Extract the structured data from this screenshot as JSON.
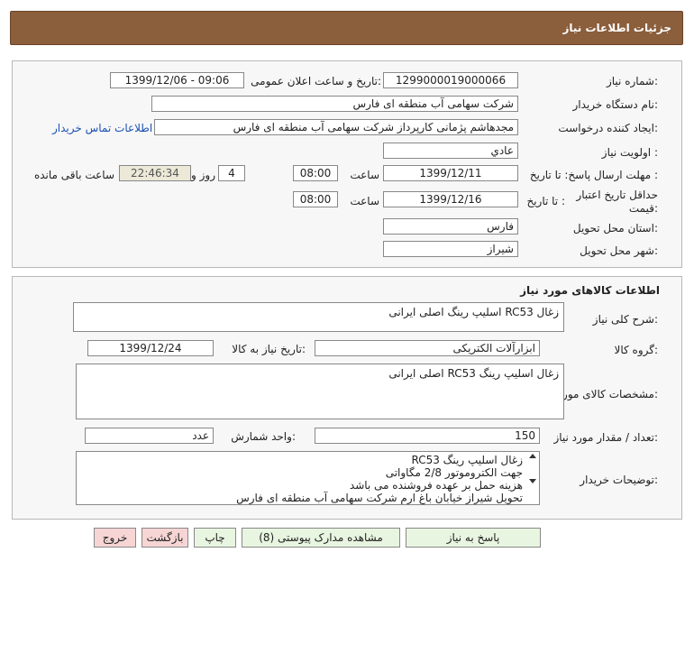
{
  "header": {
    "title": "جزئیات اطلاعات نیاز"
  },
  "need": {
    "need_number_label": "شماره نیاز:",
    "need_number": "1299000019000066",
    "announce_label": "تاریخ و ساعت اعلان عمومی:",
    "announce_value": "1399/12/06 - 09:06",
    "buyer_label": "نام دستگاه خریدار:",
    "buyer": "شرکت سهامی آب منطقه ای فارس",
    "creator_label": "ایجاد کننده درخواست:",
    "creator": "مجدهاشم پژمانی کارپرداز شرکت سهامی آب منطقه ای فارس",
    "contact_link": "اطلاعات تماس خریدار",
    "priority_label": "اولویت نیاز :",
    "priority": "عادي",
    "send_deadline_label": "مهلت ارسال پاسخ: تا تاریخ :",
    "send_date": "1399/12/11",
    "time_label": "ساعت",
    "send_time": "08:00",
    "days_value": "4",
    "days_label": "روز و",
    "remaining_time": "22:46:34",
    "remaining_label": "ساعت باقی مانده",
    "price_validity_label": "حداقل تاریخ اعتبار قیمت:",
    "price_until_label": "تا تاریخ :",
    "price_date": "1399/12/16",
    "price_time": "08:00",
    "province_label": "استان محل تحویل:",
    "province": "فارس",
    "city_label": "شهر محل تحویل:",
    "city": "شیراز"
  },
  "goods": {
    "section_title": "اطلاعات کالاهای مورد نیاز",
    "general_desc_label": "شرح کلی نیاز:",
    "general_desc": "زغال RC53 اسلیپ رینگ اصلی ایرانی",
    "group_label": "گروه کالا:",
    "group": "ابزارآلات الکتریکی",
    "need_date_label": "تاریخ نیاز به کالا:",
    "need_date": "1399/12/24",
    "spec_label": "مشخصات کالای مورد نیاز:",
    "spec": "زغال اسلیپ رینگ RC53 اصلی ایرانی",
    "qty_label": "تعداد / مقدار مورد نیاز:",
    "qty": "150",
    "unit_label": "واحد شمارش:",
    "unit": "عدد",
    "buyer_notes_label": "توضیحات خریدار:",
    "buyer_notes": [
      "زغال اسلیپ رینگ RC53",
      "جهت الکتروموتور 2/8 مگاواتی",
      "هزینه حمل بر عهده فروشنده می باشد",
      "تحویل شیراز خیابان باغ ارم شرکت سهامی آب منطقه ای فارس"
    ]
  },
  "buttons": {
    "reply": "پاسخ به نیاز",
    "attachments": "مشاهده مدارک پیوستی (8)",
    "print": "چاپ",
    "back": "بازگشت",
    "exit": "خروج"
  },
  "colors": {
    "header_bg": "#8b5e3c",
    "button_green": "#e8f5e0",
    "button_red": "#f7d5d5",
    "link": "#1a4fb5"
  }
}
